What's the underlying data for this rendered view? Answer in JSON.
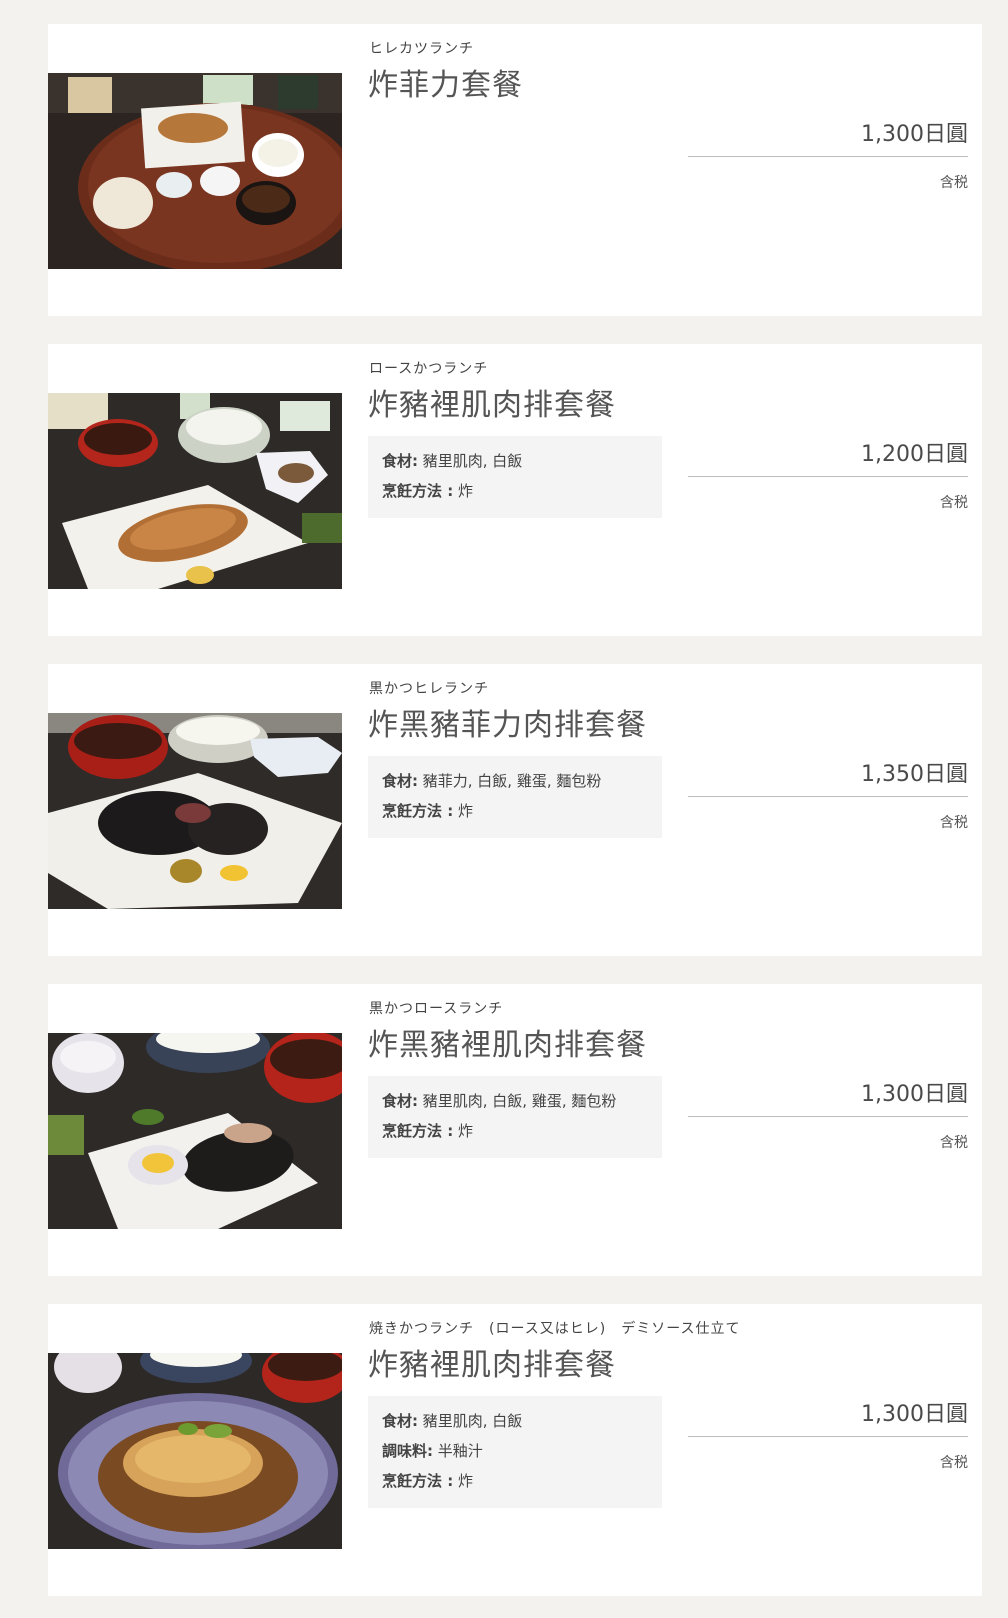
{
  "items": [
    {
      "subtitle": "ヒレカツランチ",
      "title": "炸菲力套餐",
      "price": "1,300日圓",
      "tax_note": "含税",
      "photo_alt": "ヒレカツランチ",
      "info": []
    },
    {
      "subtitle": "ロースかつランチ",
      "title": "炸豬裡肌肉排套餐",
      "price": "1,200日圓",
      "tax_note": "含税",
      "photo_alt": "ロースかつランチ",
      "info": [
        {
          "key": "食材:",
          "value": " 豬里肌肉, 白飯"
        },
        {
          "key": "烹飪方法 :",
          "value": " 炸"
        }
      ]
    },
    {
      "subtitle": "黒かつヒレランチ",
      "title": "炸黑豬菲力肉排套餐",
      "price": "1,350日圓",
      "tax_note": "含税",
      "photo_alt": "黒かつヒレランチ",
      "info": [
        {
          "key": "食材:",
          "value": " 豬菲力, 白飯, 雞蛋, 麵包粉"
        },
        {
          "key": "烹飪方法 :",
          "value": " 炸"
        }
      ]
    },
    {
      "subtitle": "黒かつロースランチ",
      "title": "炸黑豬裡肌肉排套餐",
      "price": "1,300日圓",
      "tax_note": "含税",
      "photo_alt": "黒かつロースランチ",
      "info": [
        {
          "key": "食材:",
          "value": " 豬里肌肉, 白飯, 雞蛋, 麵包粉"
        },
        {
          "key": "烹飪方法 :",
          "value": " 炸"
        }
      ]
    },
    {
      "subtitle": "焼きかつランチ　(ロース又はヒレ)　デミソース仕立て",
      "title": "炸豬裡肌肉排套餐",
      "price": "1,300日圓",
      "tax_note": "含税",
      "photo_alt": "焼きかつランチ",
      "info": [
        {
          "key": "食材:",
          "value": " 豬里肌肉, 白飯"
        },
        {
          "key": "調味料:",
          "value": " 半釉汁"
        },
        {
          "key": "烹飪方法 :",
          "value": " 炸"
        }
      ]
    }
  ]
}
